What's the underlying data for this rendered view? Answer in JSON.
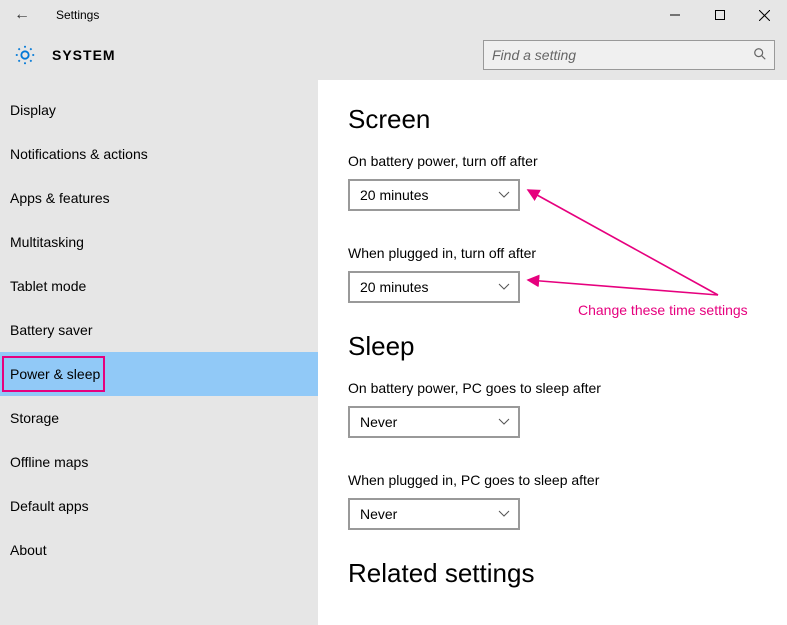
{
  "window": {
    "title": "Settings"
  },
  "header": {
    "label": "SYSTEM",
    "search_placeholder": "Find a setting"
  },
  "sidebar": {
    "items": [
      {
        "label": "Display"
      },
      {
        "label": "Notifications & actions"
      },
      {
        "label": "Apps & features"
      },
      {
        "label": "Multitasking"
      },
      {
        "label": "Tablet mode"
      },
      {
        "label": "Battery saver"
      },
      {
        "label": "Power & sleep"
      },
      {
        "label": "Storage"
      },
      {
        "label": "Offline maps"
      },
      {
        "label": "Default apps"
      },
      {
        "label": "About"
      }
    ]
  },
  "content": {
    "screen": {
      "heading": "Screen",
      "battery_label": "On battery power, turn off after",
      "battery_value": "20 minutes",
      "plugged_label": "When plugged in, turn off after",
      "plugged_value": "20 minutes"
    },
    "sleep": {
      "heading": "Sleep",
      "battery_label": "On battery power, PC goes to sleep after",
      "battery_value": "Never",
      "plugged_label": "When plugged in, PC goes to sleep after",
      "plugged_value": "Never"
    },
    "related_heading": "Related settings"
  },
  "annotation": {
    "text": "Change these time settings",
    "color": "#e6007e"
  }
}
